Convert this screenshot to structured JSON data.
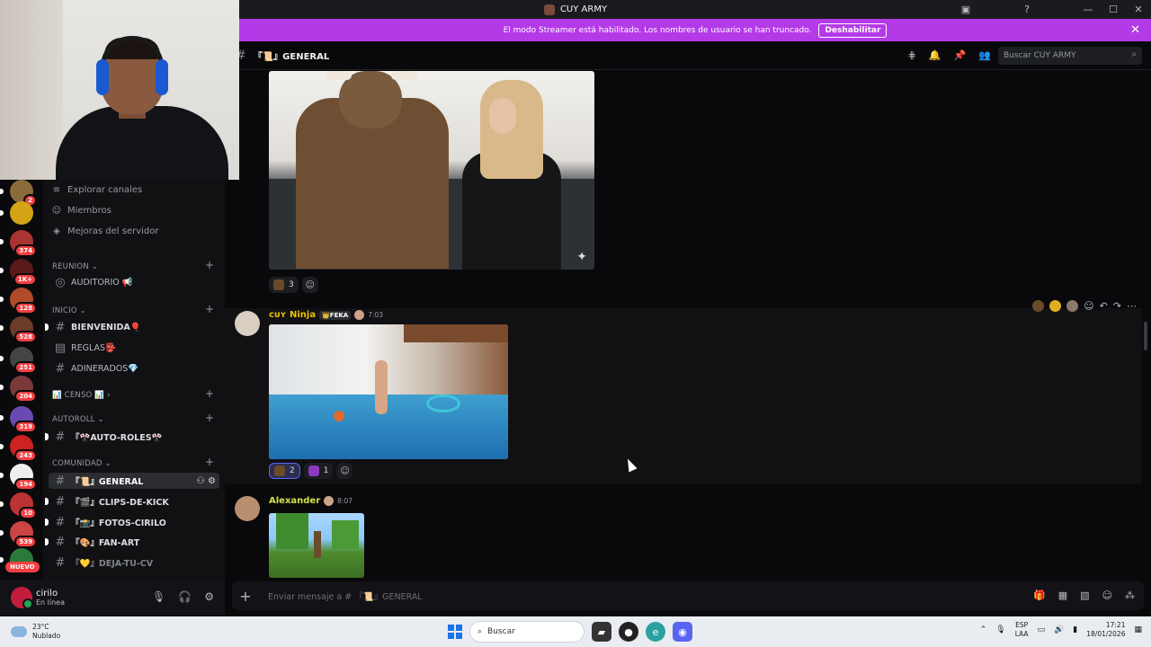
{
  "window": {
    "title": "CUY ARMY"
  },
  "banner": {
    "text": "El modo Streamer está habilitado. Los nombres de usuario se han truncado.",
    "button_label": "Deshabilitar"
  },
  "sidebar": {
    "top_items": [
      {
        "label": "Explorar canales",
        "icon": "compass-icon"
      },
      {
        "label": "Miembros",
        "icon": "members-icon"
      },
      {
        "label": "Mejoras del servidor",
        "icon": "boost-icon"
      }
    ],
    "categories": {
      "reunion": "REUNION",
      "inicio": "INICIO",
      "censo": "📊 CENSO 📊",
      "autoroll": "AUTOROLL",
      "comunidad": "COMUNIDAD"
    },
    "channels": {
      "auditorio": "AUDITORIO 📢",
      "bienvenida": "BIENVENIDA🎈",
      "reglas": "REGLAS👺",
      "adinerados": "ADINERADOS💎",
      "auto_roles": "『🎌AUTO-ROLES🎌",
      "general": "『📜』GENERAL",
      "clips": "『🎬』CLIPS-DE-KICK",
      "fotos": "『📸』FOTOS-CIRILO",
      "fanart": "『🎨』FAN-ART",
      "deja_cv": "『💛』DEJA-TU-CV"
    },
    "servers": [
      {
        "badge": "2",
        "color": "#8a6a3a"
      },
      {
        "badge": "",
        "color": "#d4a316"
      },
      {
        "badge": "374",
        "color": "#a33"
      },
      {
        "badge": "1K+",
        "color": "#5a1a1a"
      },
      {
        "badge": "128",
        "color": "#b04a2a"
      },
      {
        "badge": "528",
        "color": "#6b3c2a"
      },
      {
        "badge": "251",
        "color": "#444"
      },
      {
        "badge": "204",
        "color": "#7a3a3a"
      },
      {
        "badge": "319",
        "color": "#6a4ab0"
      },
      {
        "badge": "243",
        "color": "#c22"
      },
      {
        "badge": "194",
        "color": "#eee"
      },
      {
        "badge": "10",
        "color": "#b33"
      },
      {
        "badge": "539",
        "color": "#c44"
      },
      {
        "badge": "",
        "color": "#2a7a3a"
      }
    ],
    "new_badge": "NUEVO"
  },
  "user": {
    "name": "cirilo",
    "status": "En línea"
  },
  "header": {
    "channel": "『📜』GENERAL",
    "search_placeholder": "Buscar CUY ARMY"
  },
  "messages": {
    "first_reactions": [
      {
        "count": "3",
        "color": "#6b4a2a"
      }
    ],
    "ninja": {
      "name": "ᴄᴜʏ Ninja",
      "tag": "👑FEKA",
      "time": "7:03",
      "reactions": [
        {
          "count": "2",
          "color": "#6b4a2a"
        },
        {
          "count": "1",
          "color": "#8b3ac2"
        }
      ]
    },
    "alexander": {
      "name": "Alexander",
      "time": "8:07"
    }
  },
  "composer": {
    "placeholder": "Enviar mensaje a # 『📜』GENERAL"
  },
  "taskbar": {
    "temp": "23°C",
    "weather": "Nublado",
    "search": "Buscar",
    "lang_top": "ESP",
    "lang_bottom": "LAA",
    "time": "17:21",
    "date": "18/01/2026"
  }
}
